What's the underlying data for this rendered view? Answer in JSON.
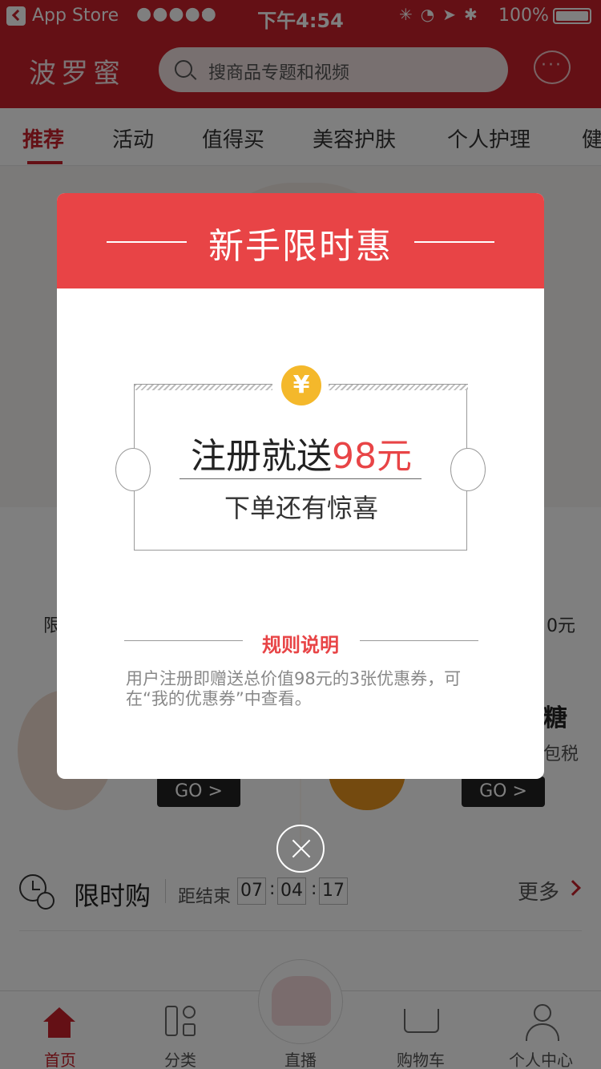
{
  "status_bar": {
    "carrier": "App Store",
    "signal": "●●●●●",
    "time": "下午4:54",
    "battery": "100%"
  },
  "header": {
    "logo": "波罗蜜",
    "search_placeholder": "搜商品专题和视频"
  },
  "tabs": [
    "推荐",
    "活动",
    "值得买",
    "美容护肤",
    "个人护理",
    "健"
  ],
  "background": {
    "icon_labels_partial": [
      "限",
      "0元"
    ],
    "promo_right_title_partial": "糖",
    "promo_right_sub_partial": "包税",
    "go_label": "GO >",
    "flash_sale": {
      "title": "限时购",
      "ends_label": "距结束",
      "hours": "07",
      "minutes": "04",
      "seconds": "17",
      "more": "更多"
    }
  },
  "tabbar": [
    {
      "label": "首页",
      "icon": "home-icon",
      "active": true
    },
    {
      "label": "分类",
      "icon": "category-icon",
      "active": false
    },
    {
      "label": "直播",
      "icon": "live-mascot-icon",
      "active": false
    },
    {
      "label": "购物车",
      "icon": "cart-icon",
      "active": false
    },
    {
      "label": "个人中心",
      "icon": "person-icon",
      "active": false
    }
  ],
  "modal": {
    "title": "新手限时惠",
    "coin_symbol": "¥",
    "offer_prefix": "注册就送",
    "offer_amount": "98元",
    "offer_sub": "下单还有惊喜",
    "rules_title": "规则说明",
    "rules_text": "用户注册即赠送总价值98元的3张优惠券，可在“我的优惠券”中查看。"
  },
  "colors": {
    "brand_red": "#c8202a",
    "modal_red": "#e84446",
    "coin_yellow": "#f4b82b"
  }
}
